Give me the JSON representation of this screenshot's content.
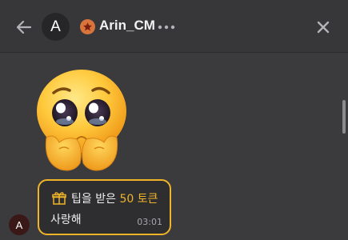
{
  "header": {
    "avatar_initial": "A",
    "username": "Arin_CM",
    "badge_icon": "star-badge-icon",
    "back_icon": "back-arrow-icon",
    "more_icon": "more-dots-icon",
    "close_icon": "close-icon"
  },
  "conversation": {
    "sticker": "pleading-face-emoji",
    "sender_initial": "A",
    "tip": {
      "gift_icon": "gift-icon",
      "prefix": "팁을 받은",
      "amount": "50",
      "unit": "토큰",
      "message": "사랑해",
      "time": "03:01"
    }
  },
  "colors": {
    "background": "#3b3b3e",
    "accent_gold": "#f0b429",
    "badge_orange": "#d9743c"
  }
}
